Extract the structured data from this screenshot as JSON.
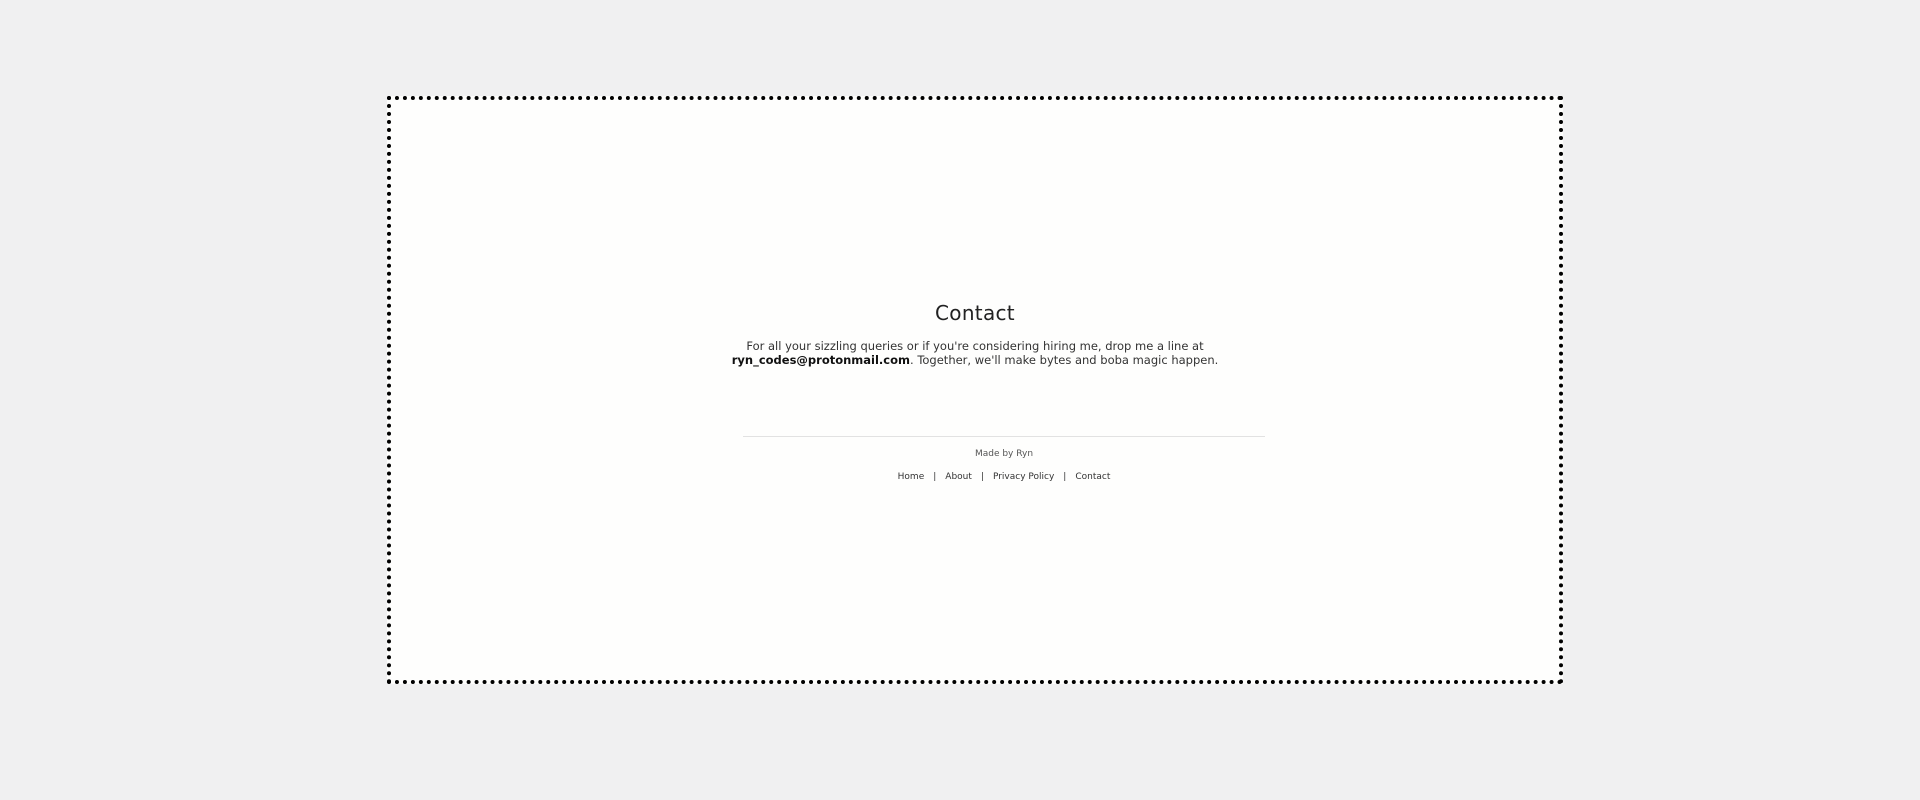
{
  "contact": {
    "title": "Contact",
    "blurb_before": "For all your sizzling queries or if you're considering hiring me, drop me a line at",
    "email": "ryn_codes@protonmail.com",
    "blurb_after": ". Together, we'll make bytes and boba magic happen."
  },
  "footer": {
    "made_by": "Made by Ryn",
    "links": [
      "Home",
      "About",
      "Privacy Policy",
      "Contact"
    ],
    "separator": "|"
  },
  "colors": {
    "page_background": "#f0f0f1",
    "card_background": "#fefefd",
    "border": "#000000",
    "text": "#222222"
  }
}
